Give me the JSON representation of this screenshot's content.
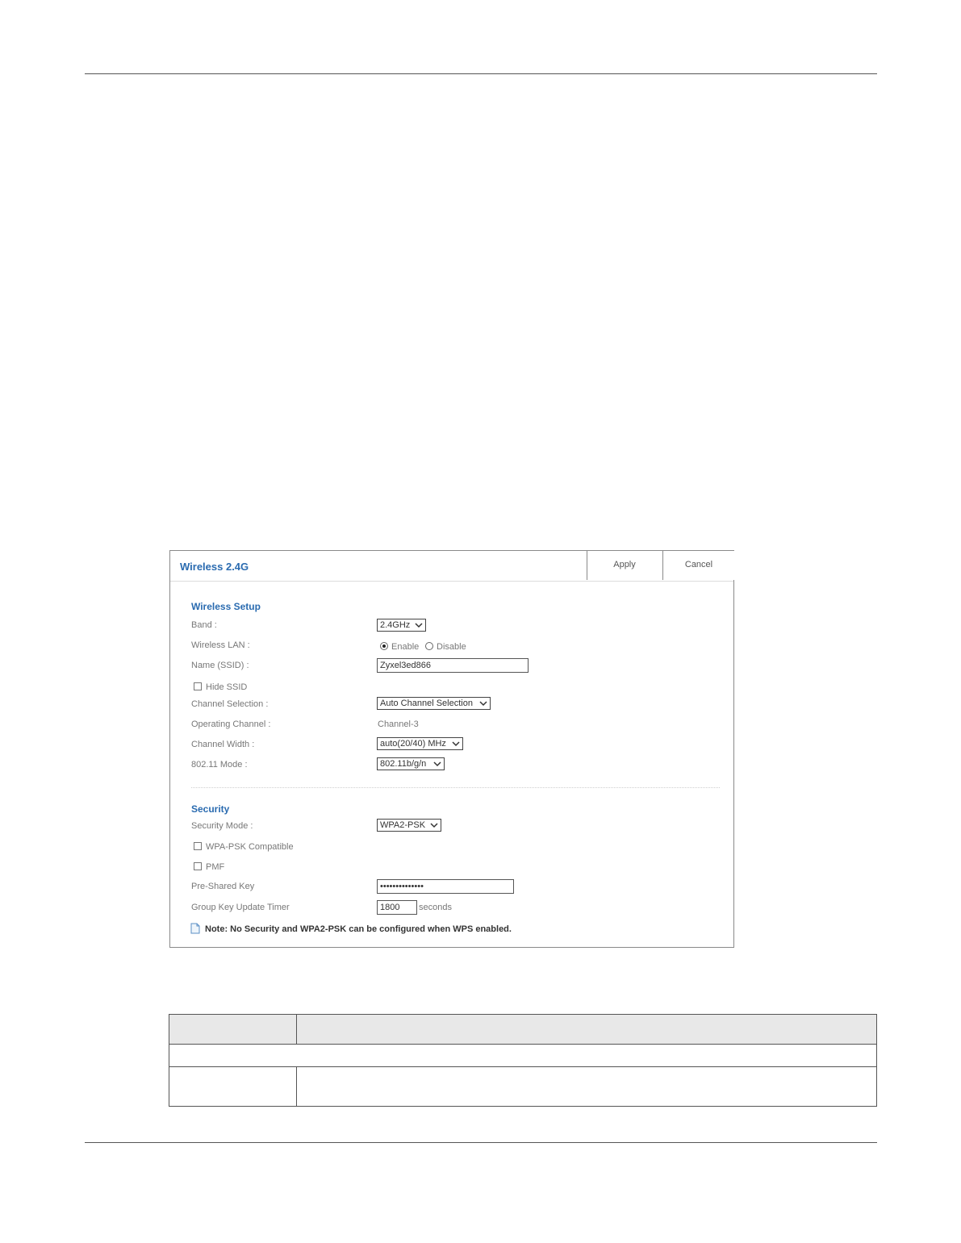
{
  "panel": {
    "title": "Wireless 2.4G",
    "apply_label": "Apply",
    "cancel_label": "Cancel"
  },
  "wireless_setup": {
    "section_title": "Wireless Setup",
    "band_label": "Band :",
    "band_value": "2.4GHz",
    "wlan_label": "Wireless LAN :",
    "wlan_enable": "Enable",
    "wlan_disable": "Disable",
    "wlan_selected": "Enable",
    "ssid_label": "Name (SSID) :",
    "ssid_value": "Zyxel3ed866",
    "hide_ssid_label": "Hide SSID",
    "channel_selection_label": "Channel Selection :",
    "channel_selection_value": "Auto Channel Selection",
    "operating_channel_label": "Operating Channel :",
    "operating_channel_value": "Channel-3",
    "channel_width_label": "Channel Width :",
    "channel_width_value": "auto(20/40) MHz",
    "mode_label": "802.11 Mode :",
    "mode_value": "802.11b/g/n"
  },
  "security": {
    "section_title": "Security",
    "mode_label": "Security Mode :",
    "mode_value": "WPA2-PSK",
    "wpa_compat_label": "WPA-PSK Compatible",
    "pmf_label": "PMF",
    "psk_label": "Pre-Shared Key",
    "psk_value": "••••••••••••••",
    "gkut_label": "Group Key Update Timer",
    "gkut_value": "1800",
    "gkut_unit": "seconds"
  },
  "note": {
    "text": "Note: No Security and WPA2-PSK can be configured when WPS enabled."
  },
  "colors": {
    "accent": "#2a6bb0",
    "table_header_bg": "#e8e8e8"
  }
}
